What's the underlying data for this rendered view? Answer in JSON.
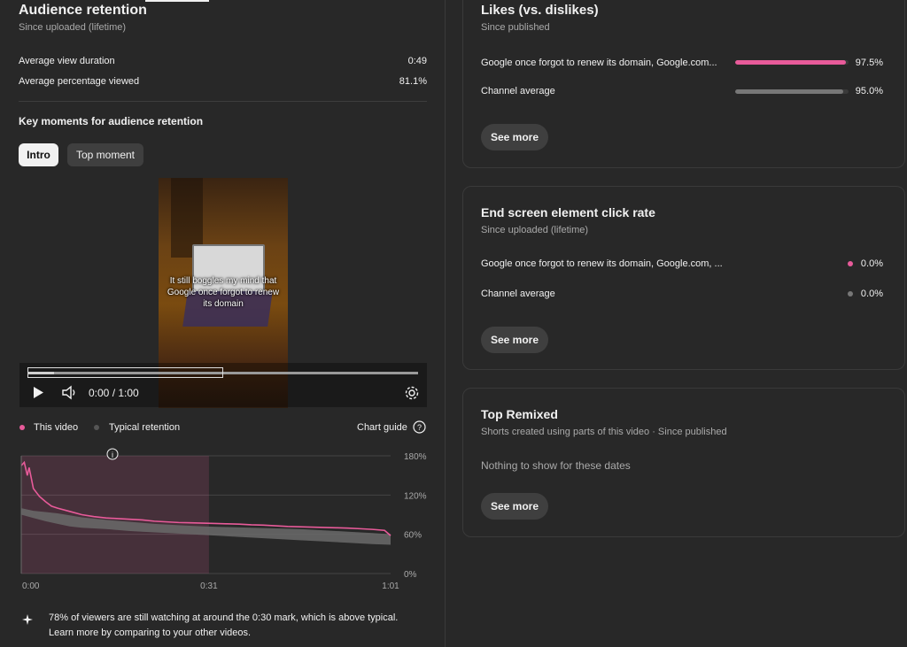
{
  "audience": {
    "title": "Audience retention",
    "subtitle": "Since uploaded (lifetime)",
    "stats": [
      {
        "label": "Average view duration",
        "value": "0:49"
      },
      {
        "label": "Average percentage viewed",
        "value": "81.1%"
      }
    ],
    "key_moments_title": "Key moments for audience retention",
    "chips": [
      {
        "label": "Intro",
        "active": true
      },
      {
        "label": "Top moment",
        "active": false
      }
    ],
    "video_caption": "It still boggles my mind that Google once forgot to renew its domain",
    "player": {
      "time": "0:00 / 1:00",
      "selection_progress": 0.5
    },
    "legend": {
      "this_video": "This video",
      "typical": "Typical retention",
      "chart_guide": "Chart guide"
    },
    "footer_text": "78% of viewers are still watching at around the 0:30 mark, which is above typical. Learn more by comparing to your other videos."
  },
  "chart_data": {
    "type": "line",
    "x_ticks": [
      "0:00",
      "0:31",
      "1:01"
    ],
    "y_ticks": [
      "180%",
      "120%",
      "60%",
      "0%"
    ],
    "ylim": [
      0,
      180
    ],
    "xlim": [
      0,
      61
    ],
    "highlight_range": [
      0,
      31
    ],
    "series": [
      {
        "name": "This video",
        "color": "#e85b9a",
        "points": [
          [
            0,
            165
          ],
          [
            0.5,
            170
          ],
          [
            1,
            150
          ],
          [
            1.3,
            162
          ],
          [
            2,
            130
          ],
          [
            3,
            118
          ],
          [
            4,
            110
          ],
          [
            5,
            103
          ],
          [
            6,
            100
          ],
          [
            8,
            95
          ],
          [
            10,
            90
          ],
          [
            12,
            87
          ],
          [
            14,
            85
          ],
          [
            16,
            84
          ],
          [
            18,
            83
          ],
          [
            20,
            82
          ],
          [
            22,
            80
          ],
          [
            24,
            79
          ],
          [
            26,
            78
          ],
          [
            28,
            77.5
          ],
          [
            30,
            77
          ],
          [
            32,
            76.5
          ],
          [
            34,
            76
          ],
          [
            36,
            75.5
          ],
          [
            38,
            74.5
          ],
          [
            40,
            74
          ],
          [
            42,
            73
          ],
          [
            44,
            72
          ],
          [
            46,
            71.5
          ],
          [
            48,
            71
          ],
          [
            50,
            70.5
          ],
          [
            52,
            70
          ],
          [
            54,
            69.5
          ],
          [
            56,
            68.5
          ],
          [
            58,
            67.5
          ],
          [
            60,
            66
          ],
          [
            61,
            58
          ]
        ]
      },
      {
        "name": "Typical retention",
        "color": "#9e9e9e",
        "upper": [
          [
            0,
            100
          ],
          [
            2,
            96
          ],
          [
            4,
            94
          ],
          [
            6,
            92
          ],
          [
            8,
            89
          ],
          [
            10,
            86
          ],
          [
            14,
            82
          ],
          [
            18,
            79
          ],
          [
            22,
            76
          ],
          [
            26,
            74
          ],
          [
            30,
            72
          ],
          [
            34,
            71
          ],
          [
            38,
            70
          ],
          [
            42,
            69
          ],
          [
            46,
            68
          ],
          [
            50,
            66
          ],
          [
            54,
            64
          ],
          [
            58,
            62
          ],
          [
            61,
            60
          ]
        ],
        "lower": [
          [
            0,
            90
          ],
          [
            2,
            85
          ],
          [
            4,
            80
          ],
          [
            6,
            76
          ],
          [
            8,
            72
          ],
          [
            10,
            70
          ],
          [
            14,
            68
          ],
          [
            18,
            65
          ],
          [
            22,
            63
          ],
          [
            26,
            61
          ],
          [
            30,
            59
          ],
          [
            34,
            57
          ],
          [
            38,
            55
          ],
          [
            42,
            53
          ],
          [
            46,
            51
          ],
          [
            50,
            49
          ],
          [
            54,
            47
          ],
          [
            58,
            45
          ],
          [
            61,
            44
          ]
        ]
      }
    ]
  },
  "likes": {
    "title": "Likes (vs. dislikes)",
    "subtitle": "Since published",
    "rows": [
      {
        "label": "Google once forgot to renew its domain, Google.com...",
        "value": "97.5%",
        "fraction": 0.975,
        "kind": "pink"
      },
      {
        "label": "Channel average",
        "value": "95.0%",
        "fraction": 0.95,
        "kind": "gray"
      }
    ],
    "button": "See more"
  },
  "end_screen": {
    "title": "End screen element click rate",
    "subtitle": "Since uploaded (lifetime)",
    "rows": [
      {
        "label": "Google once forgot to renew its domain, Google.com, ...",
        "value": "0.0%",
        "dot_color": "#e85b9a"
      },
      {
        "label": "Channel average",
        "value": "0.0%",
        "dot_color": "#777777"
      }
    ],
    "button": "See more"
  },
  "top_remixed": {
    "title": "Top Remixed",
    "subtitle": "Shorts created using parts of this video · Since published",
    "empty_text": "Nothing to show for these dates",
    "button": "See more"
  },
  "colors": {
    "accent": "#e85b9a",
    "background": "#282828",
    "card_border": "#3a3a3a"
  },
  "icons": [
    "play-icon",
    "volume-icon",
    "settings-gear-icon",
    "help-circle-icon",
    "info-icon",
    "sparkle-icon"
  ]
}
